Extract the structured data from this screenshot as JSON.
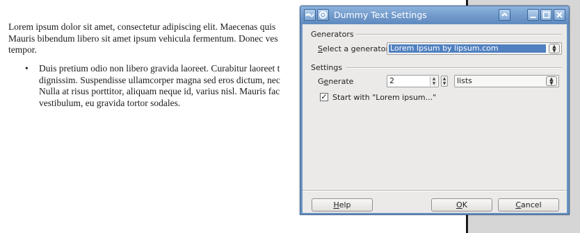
{
  "document": {
    "paragraph_lines": [
      "Lorem ipsum dolor sit amet, consectetur adipiscing elit. Maecenas quis",
      "Mauris bibendum libero sit amet ipsum vehicula fermentum. Donec ves",
      "tempor."
    ],
    "bullet_symbol": "•",
    "bullet_lines": [
      "Duis pretium odio non libero gravida laoreet. Curabitur laoreet t",
      "dignissim. Suspendisse ullamcorper magna sed eros dictum, nec",
      "Nulla at risus porttitor, aliquam neque id, varius nisl. Mauris fac",
      "vestibulum, eu gravida tortor sodales."
    ]
  },
  "dialog": {
    "title": "Dummy Text Settings",
    "icons": [
      "app-menu-icon",
      "settings-icon"
    ],
    "titlebar_buttons": {
      "shade_icon": "chevron-up-icon",
      "minimize_icon": "minimize-icon",
      "maximize_icon": "maximize-icon",
      "close_icon": "close-icon"
    },
    "generators": {
      "section_label": "Generators",
      "select_label_prefix": "",
      "select_label_accel": "S",
      "select_label_rest": "elect a generator",
      "selected_value": "Lorem Ipsum by lipsum.com"
    },
    "settings": {
      "section_label": "Settings",
      "generate_label_prefix": "G",
      "generate_label_accel": "e",
      "generate_label_rest": "nerate",
      "count_value": "2",
      "unit_value": "lists",
      "start_with_checked": true,
      "start_with_label": "Start with \"Lorem ipsum...\""
    },
    "buttons": {
      "help": {
        "accel": "H",
        "rest": "elp"
      },
      "ok": {
        "accel": "O",
        "rest": "K"
      },
      "cancel": {
        "accel": "C",
        "rest": "ancel"
      }
    },
    "colors": {
      "titlebar": "#6f98c9",
      "selection": "#5080c0",
      "dialog_bg": "#ebeae8"
    }
  }
}
